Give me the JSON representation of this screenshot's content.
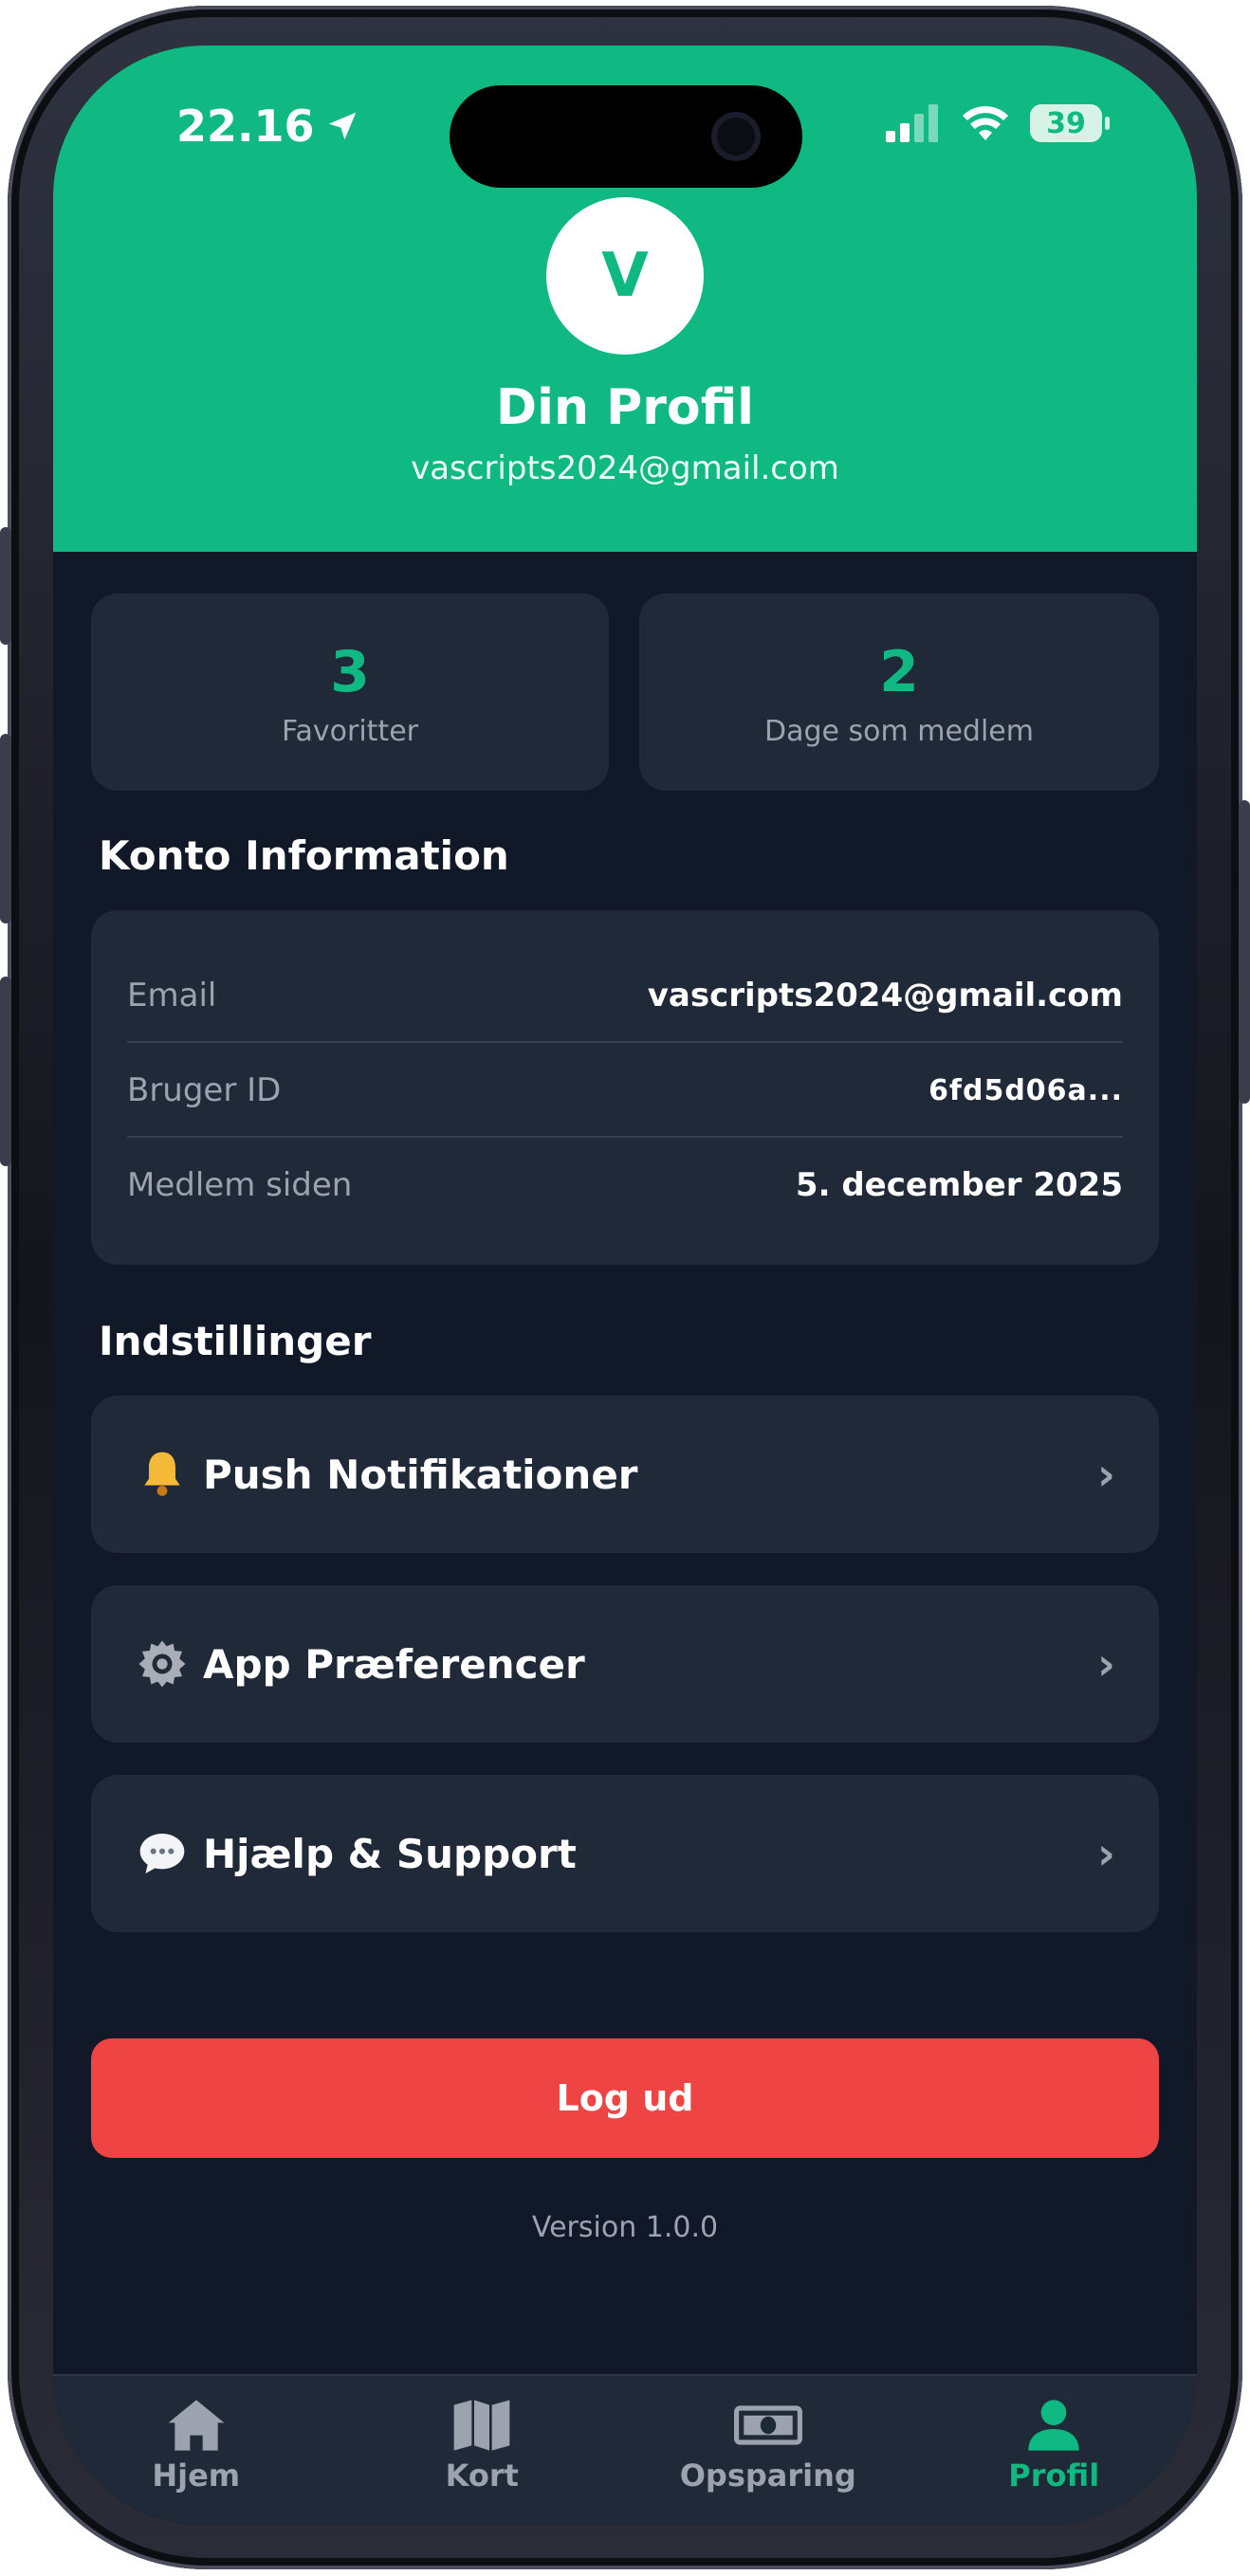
{
  "status_bar": {
    "time": "22.16",
    "battery": "39"
  },
  "profile": {
    "avatar_initial": "V",
    "title": "Din Profil",
    "email": "vascripts2024@gmail.com"
  },
  "stats": [
    {
      "value": "3",
      "label": "Favoritter"
    },
    {
      "value": "2",
      "label": "Dage som medlem"
    }
  ],
  "account": {
    "title": "Konto Information",
    "rows": [
      {
        "label": "Email",
        "value": "vascripts2024@gmail.com"
      },
      {
        "label": "Bruger ID",
        "value": "6fd5d06a..."
      },
      {
        "label": "Medlem siden",
        "value": "5. december 2025"
      }
    ]
  },
  "settings": {
    "title": "Indstillinger",
    "items": [
      {
        "icon": "bell-icon",
        "label": "Push Notifikationer"
      },
      {
        "icon": "gear-icon",
        "label": "App Præferencer"
      },
      {
        "icon": "speech-bubble-icon",
        "label": "Hjælp & Support"
      }
    ]
  },
  "logout_label": "Log ud",
  "version": "Version 1.0.0",
  "tabs": [
    {
      "icon": "home-icon",
      "label": "Hjem",
      "active": false
    },
    {
      "icon": "map-icon",
      "label": "Kort",
      "active": false
    },
    {
      "icon": "money-icon",
      "label": "Opsparing",
      "active": false
    },
    {
      "icon": "person-icon",
      "label": "Profil",
      "active": true
    }
  ],
  "colors": {
    "accent": "#10b981",
    "background": "#111827",
    "card": "#1f2937",
    "danger": "#ef4444"
  }
}
